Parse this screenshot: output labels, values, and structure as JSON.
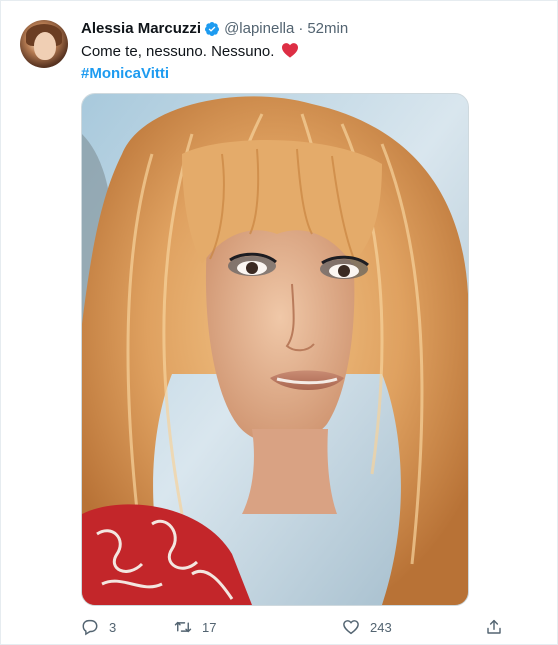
{
  "tweet": {
    "author": {
      "display_name": "Alessia Marcuzzi",
      "handle": "@lapinella",
      "verified": true,
      "avatar_icon": "avatar-photo"
    },
    "separator": "·",
    "time": "52min",
    "text": "Come te, nessuno. Nessuno.",
    "emoji_icon": "red-heart-icon",
    "hashtag": "#MonicaVitti",
    "media_icon": "portrait-photo",
    "stats": {
      "replies": "3",
      "retweets": "17",
      "likes": "243"
    },
    "colors": {
      "link": "#1d9bf0",
      "verified": "#1d9bf0",
      "muted": "#536471",
      "heart": "#e0245e"
    }
  }
}
